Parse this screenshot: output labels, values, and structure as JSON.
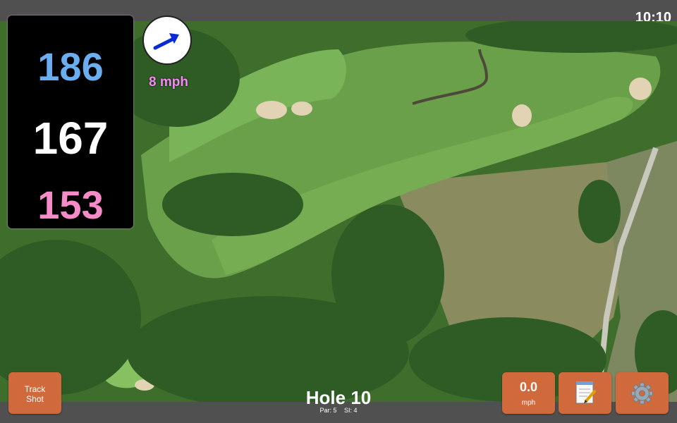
{
  "status": {
    "time": "10:10"
  },
  "distances": {
    "back": "186",
    "middle": "167",
    "front": "153"
  },
  "wind": {
    "speed": "8 mph",
    "arrow_icon": "wind-direction-arrow-icon"
  },
  "track_shot": {
    "label_line1": "Track",
    "label_line2": "Shot"
  },
  "speed": {
    "value": "0.0",
    "unit": "mph"
  },
  "hole": {
    "title": "Hole 10",
    "par": "Par: 5",
    "si": "SI: 4"
  },
  "icons": {
    "notes": "notepad-icon",
    "settings": "gear-icon"
  },
  "colors": {
    "back": "#6aaef0",
    "middle": "#ffffff",
    "front": "#f58cc8",
    "wind_text": "#f28cf2",
    "button": "#d06a3c",
    "wind_arrow": "#0a2ad8"
  }
}
